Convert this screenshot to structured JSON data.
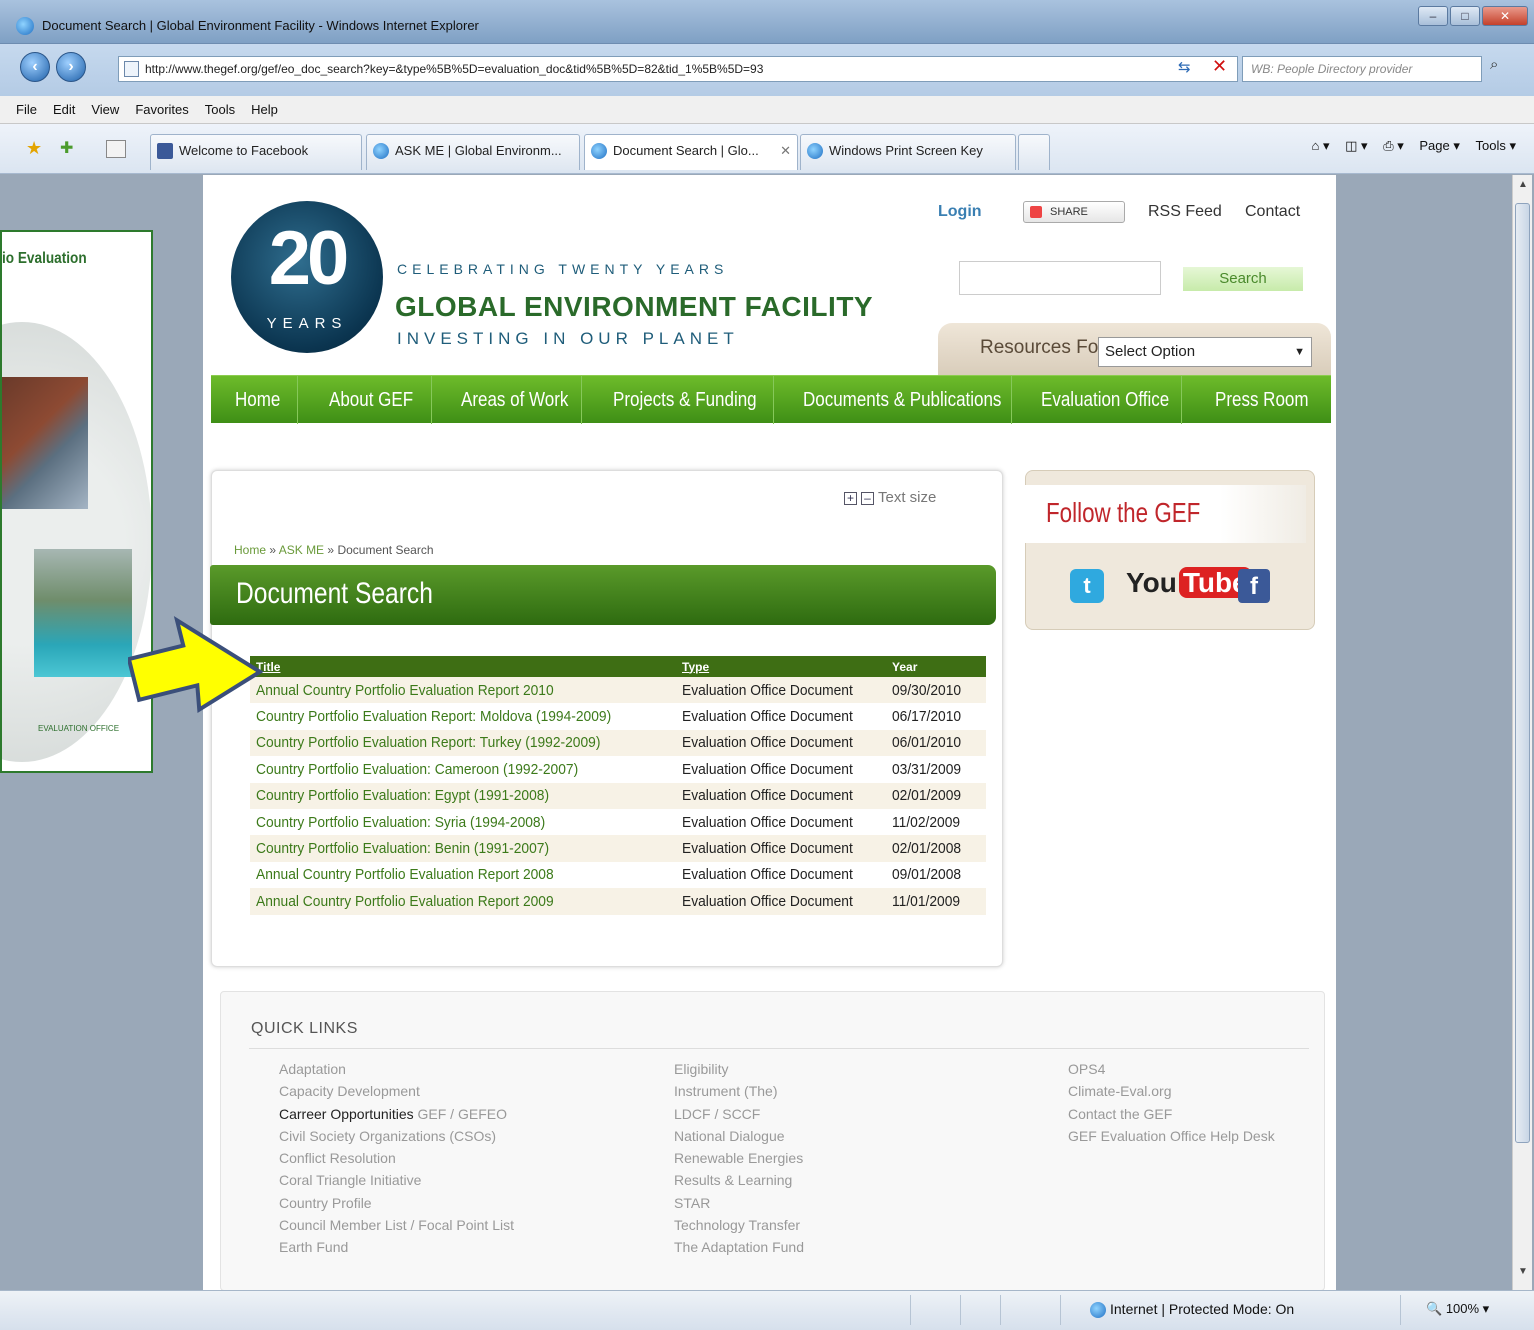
{
  "browser": {
    "window_title": "Document Search | Global Environment Facility - Windows Internet Explorer",
    "address": "http://www.thegef.org/gef/eo_doc_search?key=&type%5B%5D=evaluation_doc&tid%5B%5D=82&tid_1%5B%5D=93",
    "search_placeholder": "WB: People Directory provider",
    "menu": [
      "File",
      "Edit",
      "View",
      "Favorites",
      "Tools",
      "Help"
    ],
    "tabs": [
      {
        "label": "Welcome to Facebook"
      },
      {
        "label": "ASK ME | Global Environm..."
      },
      {
        "label": "Document Search | Glo..."
      },
      {
        "label": "Windows Print Screen Key"
      }
    ],
    "command_bar": {
      "page": "Page ▾",
      "tools": "Tools ▾"
    },
    "status_zone": "Internet | Protected Mode: On",
    "zoom": "100%"
  },
  "header": {
    "logo_number": "20",
    "logo_years": "YEARS",
    "tagline_top": "CELEBRATING TWENTY YEARS",
    "org_name": "GLOBAL ENVIRONMENT FACILITY",
    "tagline_bottom": "INVESTING IN OUR PLANET",
    "login": "Login",
    "share": "SHARE",
    "rss": "RSS Feed",
    "contact": "Contact",
    "search_button": "Search",
    "resources_label": "Resources For",
    "resources_select": "Select Option"
  },
  "nav": [
    "Home",
    "About GEF",
    "Areas of Work",
    "Projects & Funding",
    "Documents & Publications",
    "Evaluation Office",
    "Press Room"
  ],
  "content": {
    "text_size": "Text size",
    "breadcrumb": {
      "home": "Home",
      "askme": "ASK ME",
      "current": "Document Search",
      "sep": "»"
    },
    "page_title": "Document Search",
    "table": {
      "headers": {
        "title": "Title",
        "type": "Type",
        "year": "Year"
      },
      "rows": [
        {
          "title": "Annual Country Portfolio Evaluation Report 2010",
          "type": "Evaluation Office Document",
          "year": "09/30/2010"
        },
        {
          "title": "Country Portfolio Evaluation Report: Moldova (1994-2009)",
          "type": "Evaluation Office Document",
          "year": "06/17/2010"
        },
        {
          "title": "Country Portfolio Evaluation Report: Turkey (1992-2009)",
          "type": "Evaluation Office Document",
          "year": "06/01/2010"
        },
        {
          "title": "Country Portfolio Evaluation: Cameroon (1992-2007)",
          "type": "Evaluation Office Document",
          "year": "03/31/2009"
        },
        {
          "title": "Country Portfolio Evaluation: Egypt (1991-2008)",
          "type": "Evaluation Office Document",
          "year": "02/01/2009"
        },
        {
          "title": "Country Portfolio Evaluation: Syria (1994-2008)",
          "type": "Evaluation Office Document",
          "year": "11/02/2009"
        },
        {
          "title": "Country Portfolio Evaluation: Benin (1991-2007)",
          "type": "Evaluation Office Document",
          "year": "02/01/2008"
        },
        {
          "title": "Annual Country Portfolio Evaluation Report 2008",
          "type": "Evaluation Office Document",
          "year": "09/01/2008"
        },
        {
          "title": "Annual Country Portfolio Evaluation Report 2009",
          "type": "Evaluation Office Document",
          "year": "11/01/2009"
        }
      ]
    }
  },
  "follow": {
    "title": "Follow the GEF",
    "twitter": "t",
    "youtube_you": "You",
    "youtube_tube": "Tube",
    "facebook": "f"
  },
  "quick_links": {
    "title": "QUICK LINKS",
    "col1": [
      "Adaptation",
      "Capacity Development",
      "Civil Society Organizations (CSOs)",
      "Conflict Resolution",
      "Coral Triangle Initiative",
      "Country Profile",
      "Council Member List / Focal Point List",
      "Earth Fund"
    ],
    "careers": {
      "bold": "Carreer Opportunities",
      "rest": "GEF / GEFEO"
    },
    "col2": [
      "Eligibility",
      "Instrument (The)",
      "LDCF / SCCF",
      "National Dialogue",
      "Renewable Energies",
      "Results & Learning",
      "STAR",
      "Technology Transfer",
      "The Adaptation Fund"
    ],
    "col3": [
      "OPS4",
      "Climate-Eval.org",
      "Contact the GEF",
      "GEF Evaluation Office Help Desk"
    ]
  },
  "overlay": {
    "brochure_title": "io Evaluation",
    "brochure_footer": "EVALUATION OFFICE",
    "arrow_color": "#ffff00"
  }
}
